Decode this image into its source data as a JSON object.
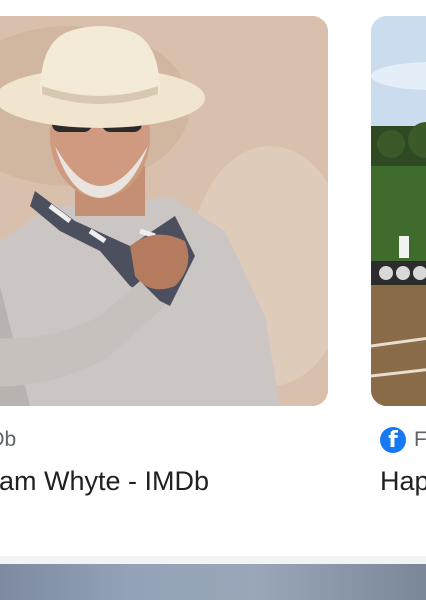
{
  "results": [
    {
      "source": "IMDb",
      "title": "Adam Whyte - IMDb",
      "icon": "imdb-icon"
    },
    {
      "source": "Facebook",
      "title": "Happy",
      "icon": "facebook-icon",
      "icon_color": "#1877f2"
    }
  ],
  "colors": {
    "source_text": "#5f6368",
    "title_text": "#202124",
    "divider": "#f1f3f4"
  }
}
